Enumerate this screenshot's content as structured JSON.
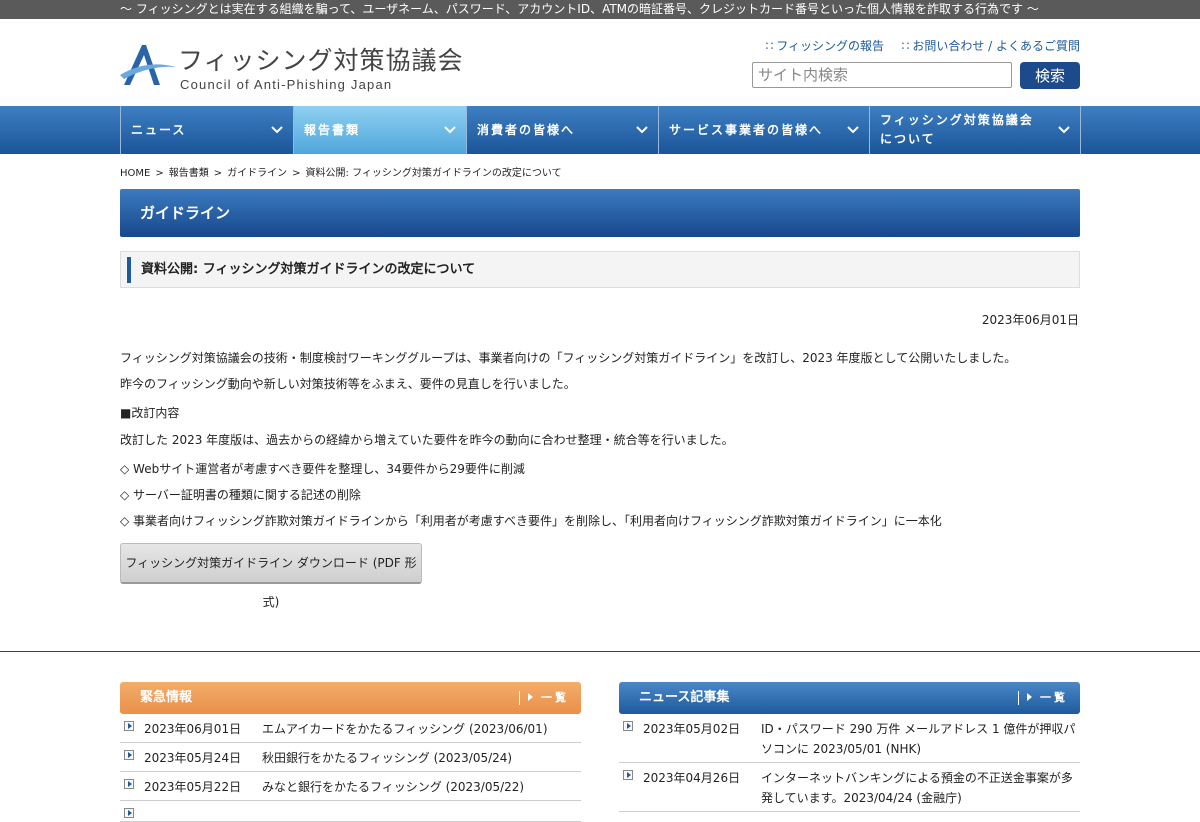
{
  "topbar": {
    "text": "〜 フィッシングとは実在する組織を騙って、ユーザネーム、パスワード、アカウントID、ATMの暗証番号、クレジットカード番号といった個人情報を詐取する行為です 〜"
  },
  "logo": {
    "jp": "フィッシング対策協議会",
    "en": "Council of Anti-Phishing Japan"
  },
  "header_links": {
    "report": "フィッシングの報告",
    "contact": "お問い合わせ / よくあるご質問"
  },
  "search": {
    "placeholder": "サイト内検索",
    "button": "検索"
  },
  "nav": [
    {
      "label": "ニュース"
    },
    {
      "label": "報告書類"
    },
    {
      "label": "消費者の皆様へ"
    },
    {
      "label": "サービス事業者の皆様へ"
    },
    {
      "label": "フィッシング対策協議会について"
    }
  ],
  "nav_extra": {
    "about_line1": "フィッシング対策協議会",
    "about_line2": "について"
  },
  "breadcrumb": [
    "HOME",
    "報告書類",
    "ガイドライン",
    "資料公開: フィッシング対策ガイドラインの改定について"
  ],
  "section_title": "ガイドライン",
  "article": {
    "title": "資料公開: フィッシング対策ガイドラインの改定について",
    "date": "2023年06月01日",
    "p1": "フィッシング対策協議会の技術・制度検討ワーキンググループは、事業者向けの「フィッシング対策ガイドライン」を改訂し、2023 年度版として公開いたしました。",
    "p2": "昨今のフィッシング動向や新しい対策技術等をふまえ、要件の見直しを行いました。",
    "h": "■改訂内容",
    "p3": "改訂した 2023 年度版は、過去からの経緯から増えていた要件を昨今の動向に合わせ整理・統合等を行いました。",
    "b1": "◇ Webサイト運営者が考慮すべき要件を整理し、34要件から29要件に削減",
    "b2": "◇ サーバー証明書の種類に関する記述の削除",
    "b3": "◇ 事業者向けフィッシング詐欺対策ガイドラインから「利用者が考慮すべき要件」を削除し、「利用者向けフィッシング詐欺対策ガイドライン」に一本化",
    "download": "フィッシング対策ガイドライン ダウンロード (PDF 形式)"
  },
  "urgent": {
    "title": "緊急情報",
    "more": "一覧",
    "items": [
      {
        "date": "2023年06月01日",
        "text": "エムアイカードをかたるフィッシング (2023/06/01)"
      },
      {
        "date": "2023年05月24日",
        "text": "秋田銀行をかたるフィッシング (2023/05/24)"
      },
      {
        "date": "2023年05月22日",
        "text": "みなと銀行をかたるフィッシング (2023/05/22)"
      },
      {
        "date": "",
        "text": ""
      }
    ]
  },
  "news": {
    "title": "ニュース記事集",
    "more": "一覧",
    "items": [
      {
        "date": "2023年05月02日",
        "text": "ID・パスワード 290 万件 メールアドレス 1 億件が押収パソコンに 2023/05/01 (NHK)"
      },
      {
        "date": "2023年04月26日",
        "text": "インターネットバンキングによる預金の不正送金事案が多発しています。2023/04/24 (金融庁)"
      }
    ]
  },
  "colors": {
    "nav_blue": "#1b5499",
    "urgent_orange": "#e9904a",
    "accent": "#1e5a9c"
  }
}
